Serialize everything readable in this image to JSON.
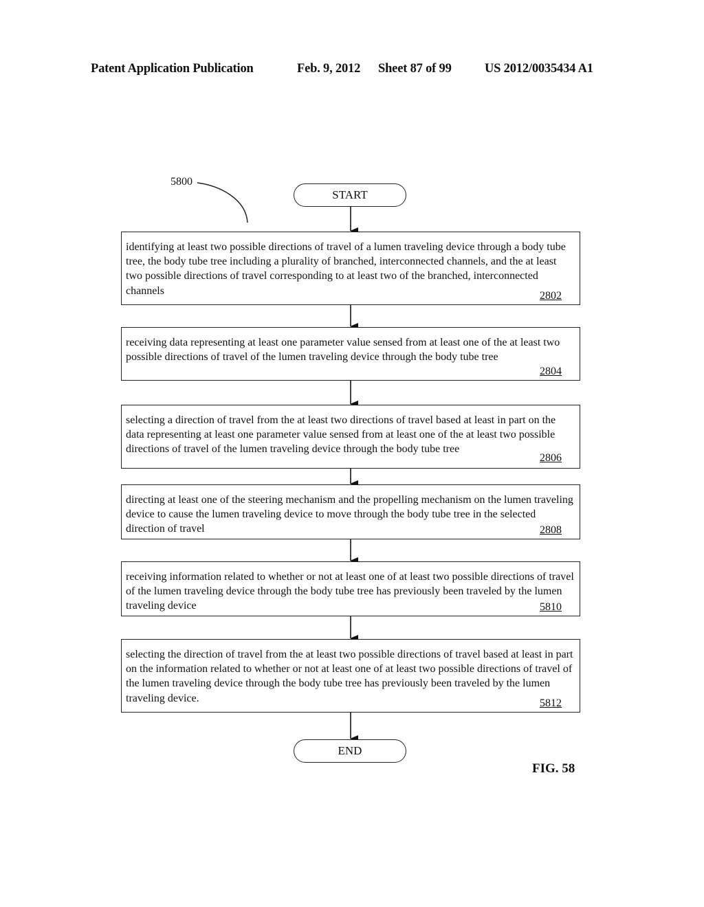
{
  "header": {
    "publication": "Patent Application Publication",
    "date": "Feb. 9, 2012",
    "sheet": "Sheet 87 of 99",
    "number": "US 2012/0035434 A1"
  },
  "diagram": {
    "reference": "5800",
    "start_label": "START",
    "end_label": "END",
    "steps": [
      {
        "text": "identifying at least two possible directions of travel of a lumen traveling device through a body tube tree, the body tube tree including a plurality of branched, interconnected channels, and the at least two possible directions of travel corresponding to at least two of the branched, interconnected channels",
        "number": "2802"
      },
      {
        "text": "receiving data representing at least one parameter value sensed from at least one of the at least two possible directions of travel of the lumen traveling device through the body tube tree",
        "number": "2804"
      },
      {
        "text": "selecting a direction of travel from the at least two directions of travel based at least in part on the data representing at least one parameter value sensed from at least one of the at least two possible directions of travel of the lumen traveling device through the body tube tree",
        "number": "2806"
      },
      {
        "text": "directing at least one of the steering mechanism and the propelling mechanism on the lumen traveling device to cause the lumen traveling device to move through the body tube tree in the selected direction of travel",
        "number": "2808"
      },
      {
        "text": "receiving information related to whether or not at least one of at least two possible directions of travel of the lumen traveling device through the body tube tree has previously been traveled by the lumen traveling device",
        "number": "5810"
      },
      {
        "text": "selecting the direction of travel from the at least two possible directions of travel based at least in part on the information related to whether or not at least one of at least two possible directions of travel of the lumen traveling device through the body tube tree has previously been traveled by the lumen traveling device.",
        "number": "5812"
      }
    ],
    "figure_label": "FIG. 58"
  }
}
